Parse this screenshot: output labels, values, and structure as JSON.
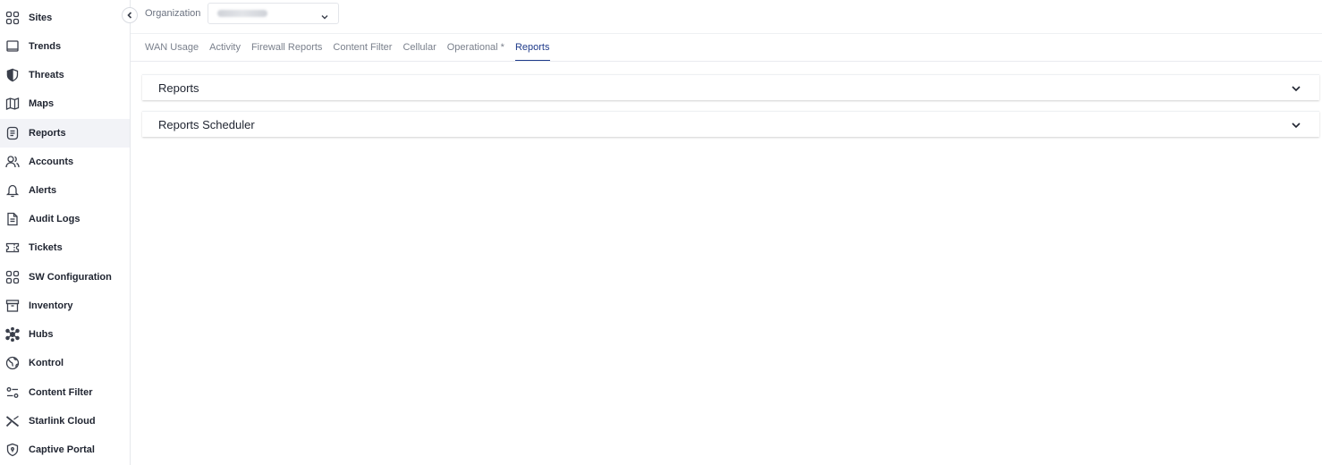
{
  "sidebar": {
    "items": [
      {
        "label": "Sites",
        "icon": "grid-icon"
      },
      {
        "label": "Trends",
        "icon": "monitor-icon"
      },
      {
        "label": "Threats",
        "icon": "shield-half-icon"
      },
      {
        "label": "Maps",
        "icon": "map-icon"
      },
      {
        "label": "Reports",
        "icon": "report-icon",
        "active": true
      },
      {
        "label": "Accounts",
        "icon": "users-icon"
      },
      {
        "label": "Alerts",
        "icon": "bell-icon"
      },
      {
        "label": "Audit Logs",
        "icon": "document-icon"
      },
      {
        "label": "Tickets",
        "icon": "ticket-icon"
      },
      {
        "label": "SW Configuration",
        "icon": "grid-icon"
      },
      {
        "label": "Inventory",
        "icon": "archive-icon"
      },
      {
        "label": "Hubs",
        "icon": "hub-icon"
      },
      {
        "label": "Kontrol",
        "icon": "globe-icon"
      },
      {
        "label": "Content Filter",
        "icon": "filter-sliders-icon"
      },
      {
        "label": "Starlink Cloud",
        "icon": "starlink-x-icon"
      },
      {
        "label": "Captive Portal",
        "icon": "shield-lock-icon"
      }
    ]
  },
  "header": {
    "org_label": "Organization",
    "org_value": ""
  },
  "tabs": [
    {
      "label": "WAN Usage"
    },
    {
      "label": "Activity"
    },
    {
      "label": "Firewall Reports"
    },
    {
      "label": "Content Filter"
    },
    {
      "label": "Cellular"
    },
    {
      "label": "Operational *"
    },
    {
      "label": "Reports",
      "active": true
    }
  ],
  "panels": [
    {
      "title": "Reports"
    },
    {
      "title": "Reports Scheduler"
    }
  ],
  "colors": {
    "accent": "#1e3a8a",
    "active_bg": "#f2f3f7"
  }
}
